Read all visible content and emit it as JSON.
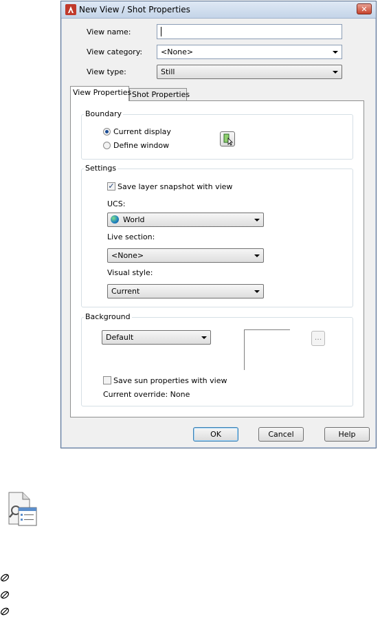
{
  "dialog": {
    "title": "New View / Shot Properties",
    "close_label": "✕"
  },
  "fields": {
    "view_name_label": "View name:",
    "view_name_value": "",
    "view_category_label": "View category:",
    "view_category_value": "<None>",
    "view_type_label": "View type:",
    "view_type_value": "Still"
  },
  "tabs": [
    {
      "label": "View Properties",
      "active": true
    },
    {
      "label": "Shot Properties",
      "active": false
    }
  ],
  "boundary": {
    "title": "Boundary",
    "option_current": "Current display",
    "option_define": "Define window",
    "selected": "Current display"
  },
  "settings": {
    "title": "Settings",
    "save_layer_snapshot_label": "Save layer snapshot with view",
    "save_layer_snapshot_checked": true,
    "ucs_label": "UCS:",
    "ucs_value": "World",
    "live_section_label": "Live section:",
    "live_section_value": "<None>",
    "visual_style_label": "Visual style:",
    "visual_style_value": "Current"
  },
  "background": {
    "title": "Background",
    "type_value": "Default",
    "browse_label": "...",
    "save_sun_label": "Save sun properties with view",
    "save_sun_checked": false,
    "override_text": "Current override: None"
  },
  "buttons": {
    "ok": "OK",
    "cancel": "Cancel",
    "help": "Help"
  },
  "colors": {
    "title_icon": "#c0392b",
    "accent": "#1b4c94"
  },
  "icons": [
    "autocad-logo-icon",
    "pick-window-icon",
    "globe-icon",
    "view-manager-icon",
    "pin-icon"
  ]
}
